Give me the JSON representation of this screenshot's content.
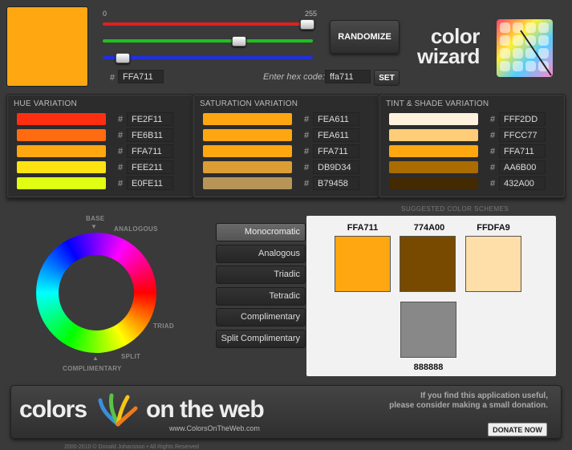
{
  "current": {
    "hex": "FFA711",
    "color": "#FFA711"
  },
  "sliders": {
    "min_label": "0",
    "max_label": "255",
    "red": {
      "value": 255,
      "color": "#e02020"
    },
    "green": {
      "value": 167,
      "color": "#20c020"
    },
    "blue": {
      "value": 17,
      "color": "#2030e0"
    }
  },
  "hash": "#",
  "randomize_label": "RANDOMIZE",
  "hex_entry": {
    "label": "Enter hex code:",
    "value": "ffa711",
    "set_label": "SET"
  },
  "logo": {
    "line1": "color",
    "line2": "wizard"
  },
  "panels": [
    {
      "title": "HUE VARIATION",
      "items": [
        {
          "hex": "FE2F11",
          "color": "#FE2F11"
        },
        {
          "hex": "FE6B11",
          "color": "#FE6B11"
        },
        {
          "hex": "FFA711",
          "color": "#FFA711"
        },
        {
          "hex": "FEE211",
          "color": "#FEE211"
        },
        {
          "hex": "E0FE11",
          "color": "#E0FE11"
        }
      ]
    },
    {
      "title": "SATURATION VARIATION",
      "items": [
        {
          "hex": "FEA611",
          "color": "#FEA611"
        },
        {
          "hex": "FEA611",
          "color": "#FEA611"
        },
        {
          "hex": "FFA711",
          "color": "#FFA711"
        },
        {
          "hex": "DB9D34",
          "color": "#DB9D34"
        },
        {
          "hex": "B79458",
          "color": "#B79458"
        }
      ]
    },
    {
      "title": "TINT & SHADE VARIATION",
      "items": [
        {
          "hex": "FFF2DD",
          "color": "#FFF2DD"
        },
        {
          "hex": "FFCC77",
          "color": "#FFCC77"
        },
        {
          "hex": "FFA711",
          "color": "#FFA711"
        },
        {
          "hex": "AA6B00",
          "color": "#AA6B00"
        },
        {
          "hex": "432A00",
          "color": "#432A00"
        }
      ]
    }
  ],
  "wheel_labels": {
    "base": "BASE",
    "analogous": "ANALOGOUS",
    "triad": "TRIAD",
    "split": "SPLIT",
    "complimentary": "COMPLIMENTARY"
  },
  "schemes": {
    "label": "SUGGESTED COLOR SCHEMES",
    "buttons": [
      "Monocromatic",
      "Analogous",
      "Triadic",
      "Tetradic",
      "Complimentary",
      "Split Complimentary"
    ],
    "active": 0,
    "swatches": [
      {
        "hex": "FFA711",
        "color": "#FFA711"
      },
      {
        "hex": "774A00",
        "color": "#774A00"
      },
      {
        "hex": "FFDFA9",
        "color": "#FFDFA9"
      },
      {
        "hex": "888888",
        "color": "#888888"
      }
    ]
  },
  "footer": {
    "brand_left": "colors",
    "brand_right": "on the web",
    "url": "www.ColorsOnTheWeb.com",
    "note_line1": "If you find this application useful,",
    "note_line2": "please consider making a small donation.",
    "donate_label": "DONATE NOW",
    "copyright": "2000-2010 © Donald Johansson • All Rights Reserved"
  }
}
